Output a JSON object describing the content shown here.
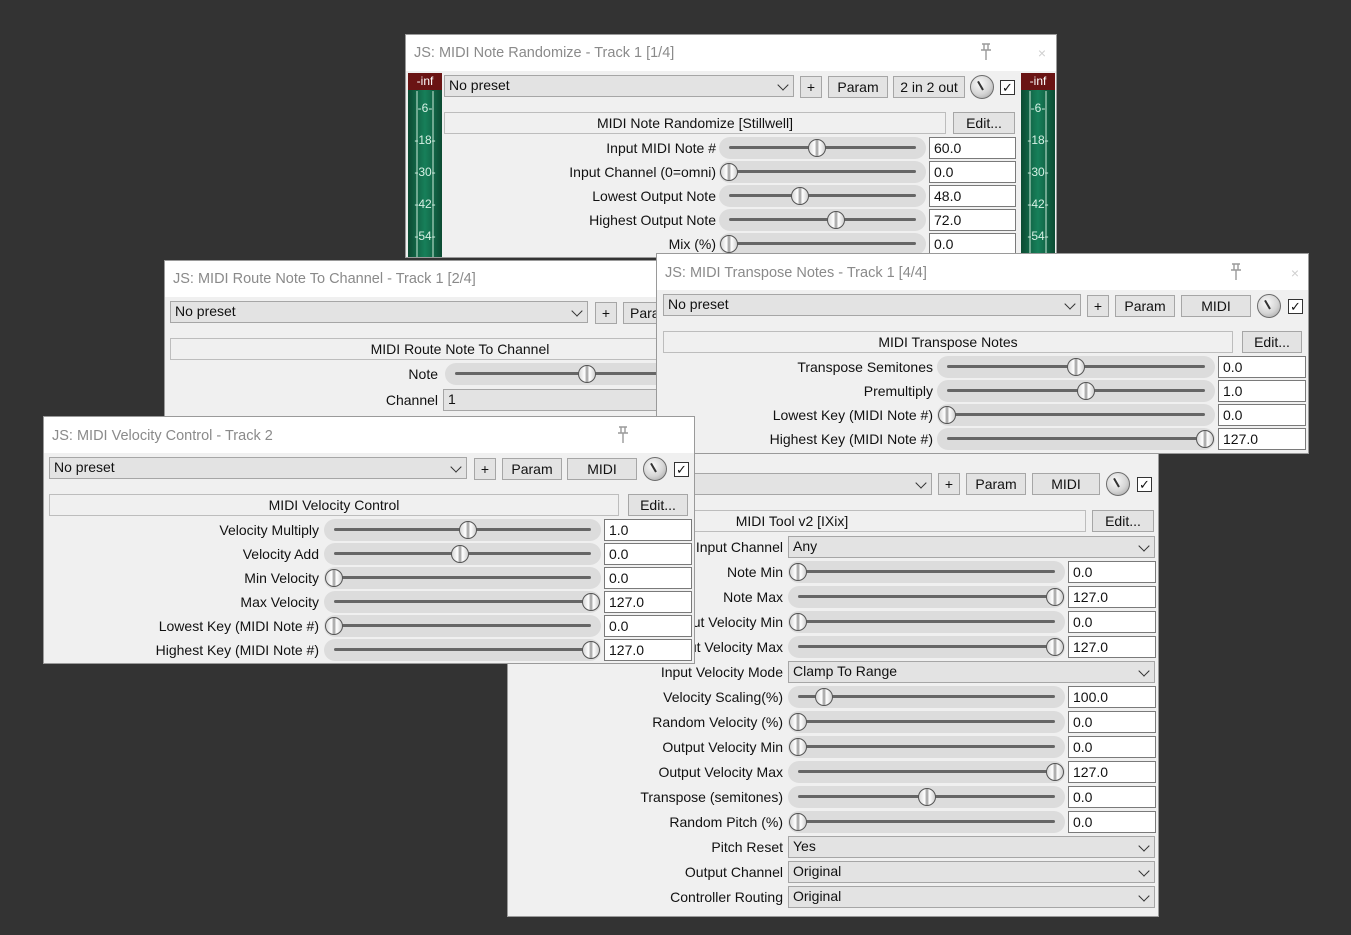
{
  "common": {
    "plus": "+",
    "param": "Param",
    "edit": "Edit...",
    "check": "✓",
    "close": "×"
  },
  "meter": {
    "cap": "-inf",
    "ticks": [
      "-6-",
      "-18-",
      "-30-",
      "-42-",
      "-54-"
    ]
  },
  "win5": {
    "preset": "",
    "io": "MIDI",
    "header": "MIDI Tool v2 [IXix]",
    "rows": [
      {
        "kind": "select",
        "label": "Input Channel",
        "value": "Any"
      },
      {
        "kind": "slider",
        "label": "Note Min",
        "value": "0.0",
        "pos": 0
      },
      {
        "kind": "slider",
        "label": "Note Max",
        "value": "127.0",
        "pos": 1
      },
      {
        "kind": "slider",
        "label": "Input Velocity Min",
        "value": "0.0",
        "pos": 0
      },
      {
        "kind": "slider",
        "label": "Input Velocity Max",
        "value": "127.0",
        "pos": 1
      },
      {
        "kind": "select",
        "label": "Input Velocity Mode",
        "value": "Clamp To Range"
      },
      {
        "kind": "slider",
        "label": "Velocity Scaling(%)",
        "value": "100.0",
        "pos": 0.1
      },
      {
        "kind": "slider",
        "label": "Random Velocity (%)",
        "value": "0.0",
        "pos": 0
      },
      {
        "kind": "slider",
        "label": "Output Velocity Min",
        "value": "0.0",
        "pos": 0
      },
      {
        "kind": "slider",
        "label": "Output Velocity Max",
        "value": "127.0",
        "pos": 1
      },
      {
        "kind": "slider",
        "label": "Transpose (semitones)",
        "value": "0.0",
        "pos": 0.5
      },
      {
        "kind": "slider",
        "label": "Random Pitch (%)",
        "value": "0.0",
        "pos": 0
      },
      {
        "kind": "select",
        "label": "Pitch Reset",
        "value": "Yes"
      },
      {
        "kind": "select",
        "label": "Output Channel",
        "value": "Original"
      },
      {
        "kind": "select",
        "label": "Controller Routing",
        "value": "Original"
      }
    ]
  },
  "win1": {
    "title": "JS: MIDI Note Randomize - Track 1 [1/4]",
    "preset": "No preset",
    "io": "2 in 2 out",
    "header": "MIDI Note Randomize [Stillwell]",
    "rows": [
      {
        "label": "Input MIDI Note #",
        "value": "60.0",
        "pos": 0.47
      },
      {
        "label": "Input Channel (0=omni)",
        "value": "0.0",
        "pos": 0
      },
      {
        "label": "Lowest Output Note",
        "value": "48.0",
        "pos": 0.38
      },
      {
        "label": "Highest Output Note",
        "value": "72.0",
        "pos": 0.57
      },
      {
        "label": "Mix (%)",
        "value": "0.0",
        "pos": 0
      }
    ]
  },
  "win2": {
    "title": "JS: MIDI Route Note To Channel - Track 1 [2/4]",
    "preset": "No preset",
    "param_partial": "Para",
    "header": "MIDI Route Note To Channel",
    "note_label": "Note",
    "note_pos": 0.47,
    "channel_label": "Channel",
    "channel_value": "1"
  },
  "win3": {
    "title": "JS: MIDI Transpose Notes - Track 1 [4/4]",
    "preset": "No preset",
    "io": "MIDI",
    "header": "MIDI Transpose Notes",
    "rows": [
      {
        "label": "Transpose Semitones",
        "value": "0.0",
        "pos": 0.5
      },
      {
        "label": "Premultiply",
        "value": "1.0",
        "pos": 0.54
      },
      {
        "label": "Lowest Key (MIDI Note #)",
        "value": "0.0",
        "pos": 0
      },
      {
        "label": "Highest Key (MIDI Note #)",
        "value": "127.0",
        "pos": 1
      }
    ]
  },
  "win4": {
    "title": "JS: MIDI Velocity Control - Track 2",
    "preset": "No preset",
    "io": "MIDI",
    "header": "MIDI Velocity Control",
    "rows": [
      {
        "label": "Velocity Multiply",
        "value": "1.0",
        "pos": 0.52
      },
      {
        "label": "Velocity Add",
        "value": "0.0",
        "pos": 0.49
      },
      {
        "label": "Min Velocity",
        "value": "0.0",
        "pos": 0
      },
      {
        "label": "Max Velocity",
        "value": "127.0",
        "pos": 1
      },
      {
        "label": "Lowest Key (MIDI Note #)",
        "value": "0.0",
        "pos": 0
      },
      {
        "label": "Highest Key (MIDI Note #)",
        "value": "127.0",
        "pos": 1
      }
    ]
  }
}
